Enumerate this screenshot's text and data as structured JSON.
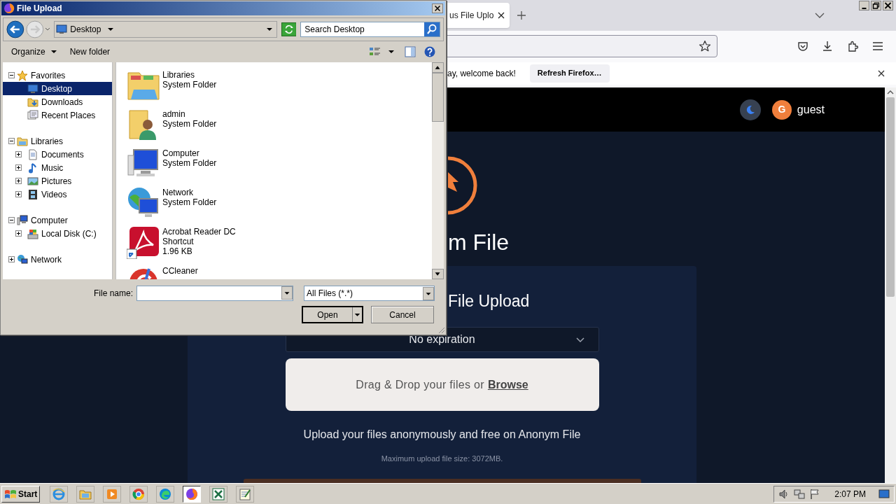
{
  "browser": {
    "tab": {
      "title": "us File Uplo"
    },
    "notification": {
      "message": "ay, welcome back!",
      "button": "Refresh Firefox…"
    },
    "header": {
      "avatar_letter": "G",
      "user": "guest"
    }
  },
  "page": {
    "heading": "m File",
    "card_title": "File Upload",
    "expiration": "No expiration",
    "dropzone": {
      "text": "Drag & Drop your files or",
      "link": "Browse"
    },
    "tagline": "Upload your files anonymously and free on Anonym File",
    "limit": "Maximum upload file size: 3072MB."
  },
  "dialog": {
    "title": "File Upload",
    "location": "Desktop",
    "search_placeholder": "Search Desktop",
    "toolbar": [
      "Organize",
      "New folder"
    ],
    "tree": [
      {
        "label": "Favorites",
        "expanded": true,
        "selected": false,
        "children": [
          {
            "label": "Desktop",
            "selected": true
          },
          {
            "label": "Downloads",
            "selected": false
          },
          {
            "label": "Recent Places",
            "selected": false
          }
        ]
      },
      {
        "label": "Libraries",
        "expanded": true,
        "selected": false,
        "children": [
          {
            "label": "Documents",
            "expanded": false,
            "selected": false
          },
          {
            "label": "Music",
            "expanded": false,
            "selected": false
          },
          {
            "label": "Pictures",
            "expanded": false,
            "selected": false
          },
          {
            "label": "Videos",
            "expanded": false,
            "selected": false
          }
        ]
      },
      {
        "label": "Computer",
        "expanded": true,
        "selected": false,
        "children": [
          {
            "label": "Local Disk (C:)",
            "expanded": false,
            "selected": false
          }
        ]
      },
      {
        "label": "Network",
        "expanded": false,
        "selected": false
      }
    ],
    "files": [
      {
        "name": "Libraries",
        "type": "System Folder"
      },
      {
        "name": "admin",
        "type": "System Folder"
      },
      {
        "name": "Computer",
        "type": "System Folder"
      },
      {
        "name": "Network",
        "type": "System Folder"
      },
      {
        "name": "Acrobat Reader DC",
        "type": "Shortcut",
        "size": "1.96 KB"
      },
      {
        "name": "CCleaner"
      }
    ],
    "file_name_label": "File name:",
    "file_type": "All Files (*.*)",
    "open": "Open",
    "cancel": "Cancel"
  },
  "taskbar": {
    "start": "Start",
    "apps": [
      {
        "selected": false
      },
      {
        "selected": false
      },
      {
        "selected": false
      },
      {
        "selected": false
      },
      {
        "selected": false
      },
      {
        "selected": true
      },
      {
        "selected": false
      },
      {
        "selected": false
      }
    ],
    "clock": "2:07 PM"
  }
}
